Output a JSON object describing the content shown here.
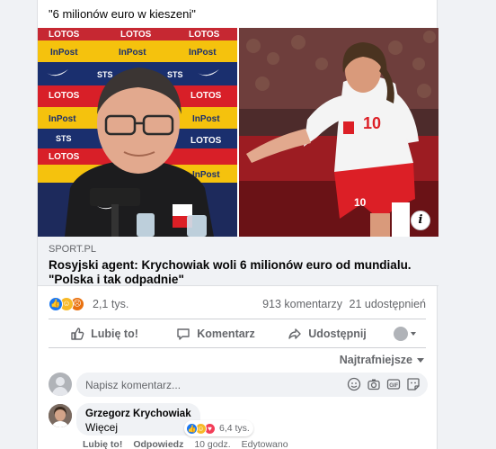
{
  "post": {
    "text": "\"6 milionów euro w kieszeni\""
  },
  "media": {
    "info_label": "i",
    "sponsor_labels": [
      "LOTOS",
      "InPost",
      "STS"
    ],
    "player_number": "10"
  },
  "link": {
    "domain": "SPORT.PL",
    "title": "Rosyjski agent: Krychowiak woli 6 milionów euro od mundialu. \"Polska i tak odpadnie\""
  },
  "reactions": {
    "icons": [
      "like-icon",
      "haha-icon",
      "angry-icon"
    ],
    "count": "2,1 tys.",
    "comments": "913 komentarzy",
    "shares": "21 udostępnień"
  },
  "actions": {
    "like": "Lubię to!",
    "comment": "Komentarz",
    "share": "Udostępnij"
  },
  "sort": {
    "label": "Najtrafniejsze"
  },
  "composer": {
    "placeholder": "Napisz komentarz..."
  },
  "comment": {
    "author": "Grzegorz Krychowiak",
    "text": "Więcej",
    "reaction_count": "6,4 tys.",
    "like": "Lubię to!",
    "reply": "Odpowiedz",
    "time": "10 godz.",
    "edited": "Edytowano"
  },
  "colors": {
    "like_blue": "#1877f2",
    "haha_yellow": "#f7b928",
    "angry_orange": "#e9710f",
    "love_red": "#f33e58",
    "sponsor_red": "#d7191c",
    "sponsor_yellow": "#f6c400",
    "kit_red": "#dc1f26"
  }
}
